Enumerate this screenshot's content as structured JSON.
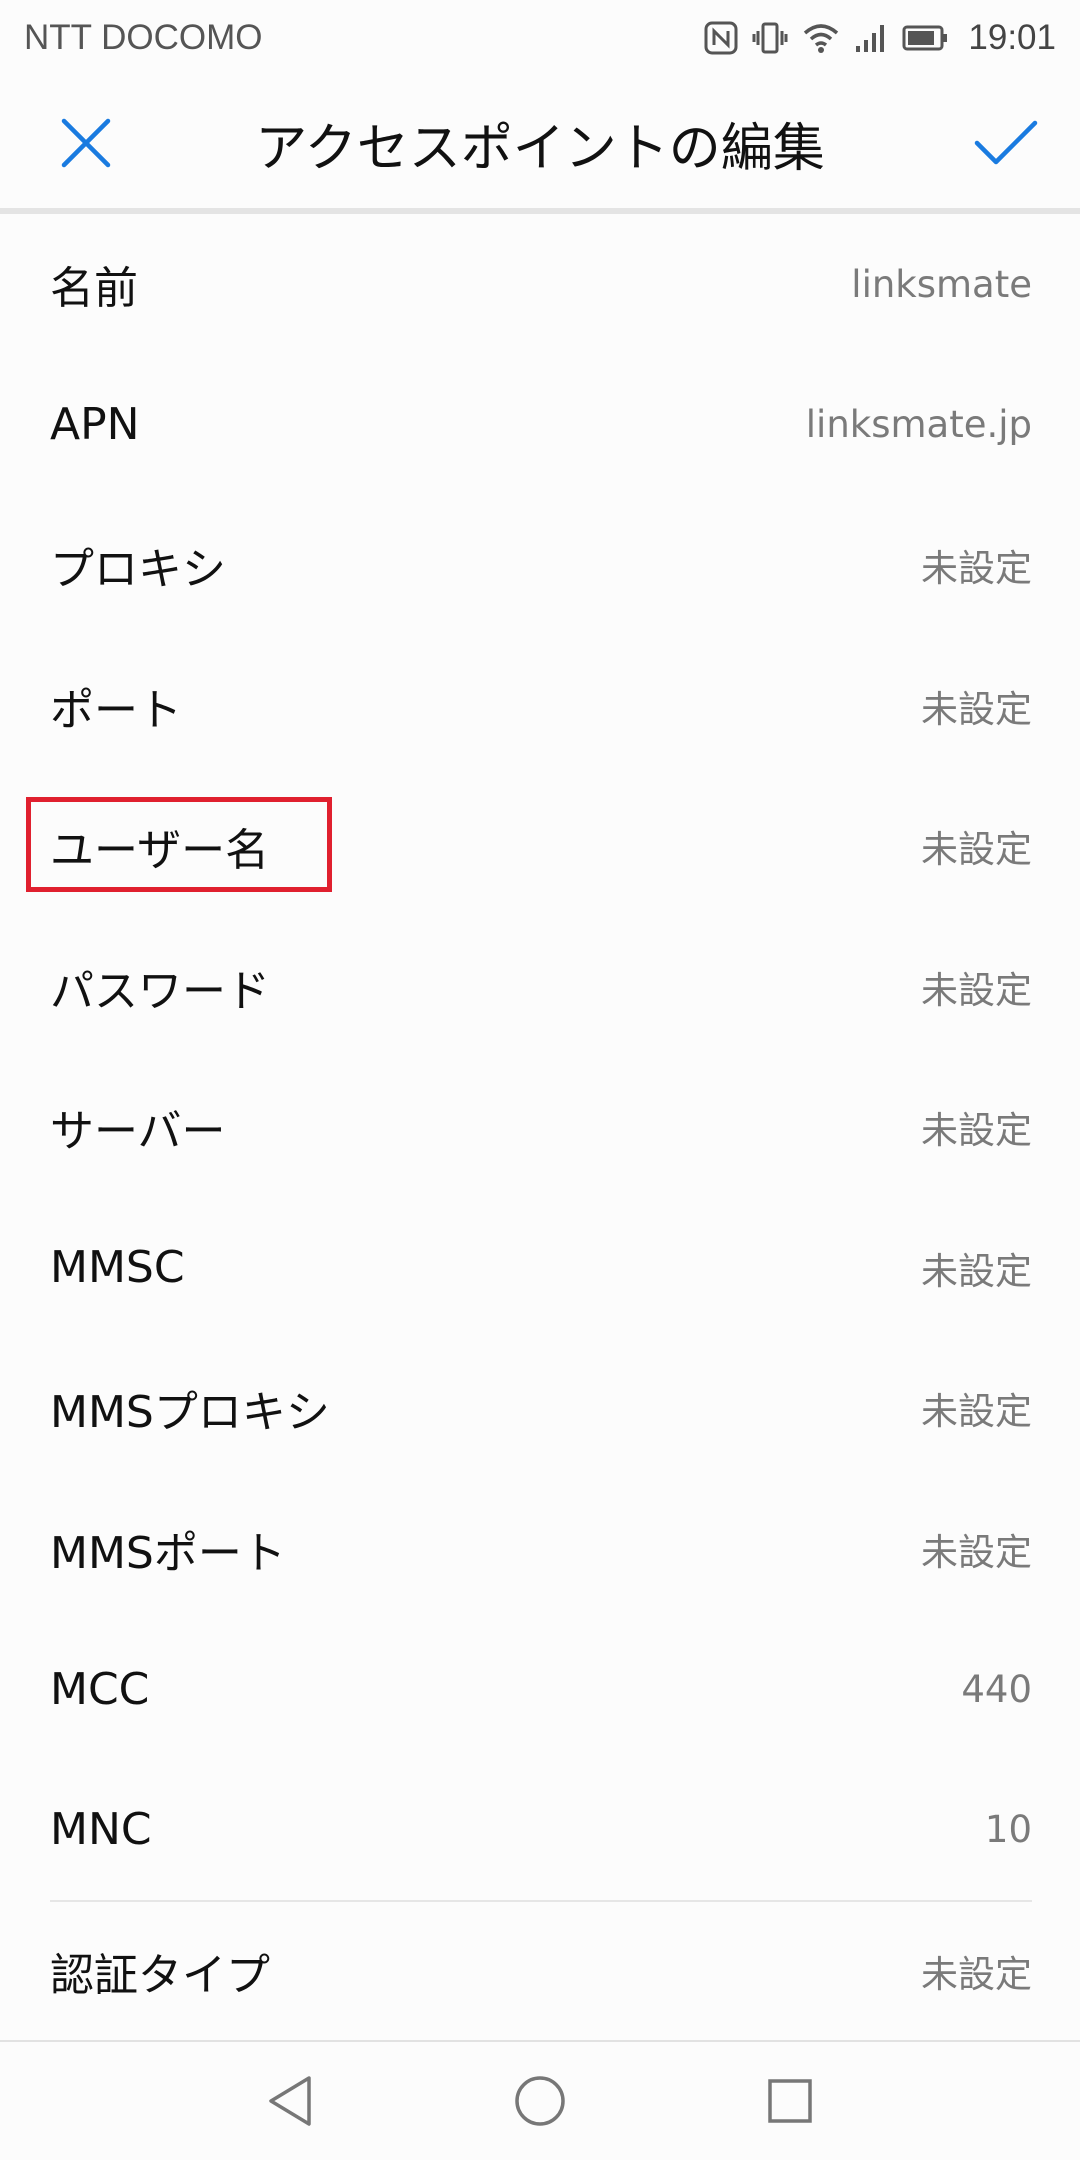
{
  "status": {
    "carrier": "NTT DOCOMO",
    "time": "19:01",
    "icons": [
      "nfc-icon",
      "vibrate-icon",
      "wifi-icon",
      "signal-icon",
      "battery-icon"
    ]
  },
  "header": {
    "title": "アクセスポイントの編集",
    "close_icon": "close-icon",
    "confirm_icon": "check-icon",
    "accent": "#1a7be0"
  },
  "settings": [
    {
      "label": "名前",
      "value": "linksmate"
    },
    {
      "label": "APN",
      "value": "linksmate.jp"
    },
    {
      "label": "プロキシ",
      "value": "未設定"
    },
    {
      "label": "ポート",
      "value": "未設定"
    },
    {
      "label": "ユーザー名",
      "value": "未設定"
    },
    {
      "label": "パスワード",
      "value": "未設定"
    },
    {
      "label": "サーバー",
      "value": "未設定"
    },
    {
      "label": "MMSC",
      "value": "未設定"
    },
    {
      "label": "MMSプロキシ",
      "value": "未設定"
    },
    {
      "label": "MMSポート",
      "value": "未設定"
    },
    {
      "label": "MCC",
      "value": "440"
    },
    {
      "label": "MNC",
      "value": "10"
    },
    {
      "label": "認証タイプ",
      "value": "未設定"
    }
  ],
  "highlight_color": "#e0202f",
  "nav": [
    "back-icon",
    "home-icon",
    "recents-icon"
  ]
}
